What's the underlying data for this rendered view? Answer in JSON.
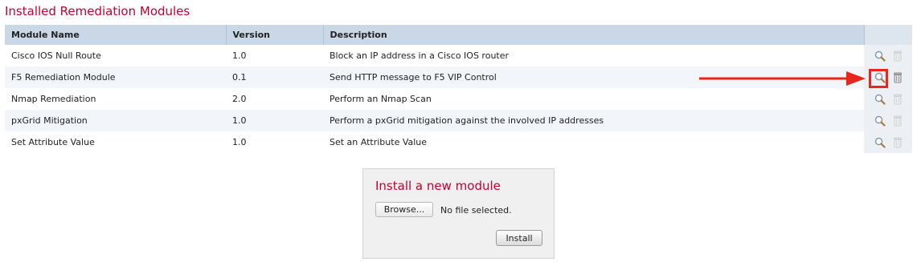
{
  "page": {
    "title": "Installed Remediation Modules"
  },
  "table": {
    "columns": {
      "name": "Module Name",
      "version": "Version",
      "description": "Description",
      "actions": ""
    },
    "rows": [
      {
        "name": "Cisco IOS Null Route",
        "version": "1.0",
        "description": "Block an IP address in a Cisco IOS router"
      },
      {
        "name": "F5 Remediation Module",
        "version": "0.1",
        "description": "Send HTTP message to F5 VIP Control"
      },
      {
        "name": "Nmap Remediation",
        "version": "2.0",
        "description": "Perform an Nmap Scan"
      },
      {
        "name": "pxGrid Mitigation",
        "version": "1.0",
        "description": "Perform a pxGrid mitigation against the involved IP addresses"
      },
      {
        "name": "Set Attribute Value",
        "version": "1.0",
        "description": "Set an Attribute Value"
      }
    ],
    "row_icons": [
      "magnifier-icon",
      "trash-can-icon"
    ]
  },
  "annotation": {
    "highlighted_row": "F5 Remediation Module",
    "highlighted_icon": "magnifier-icon",
    "color": "#e8261b"
  },
  "install": {
    "title": "Install a new module",
    "browse_label": "Browse...",
    "file_status": "No file selected.",
    "install_label": "Install"
  },
  "colors": {
    "accent": "#c4002f",
    "header_bg": "#c9d7e6",
    "row_alt_bg": "#f2f5f9"
  }
}
